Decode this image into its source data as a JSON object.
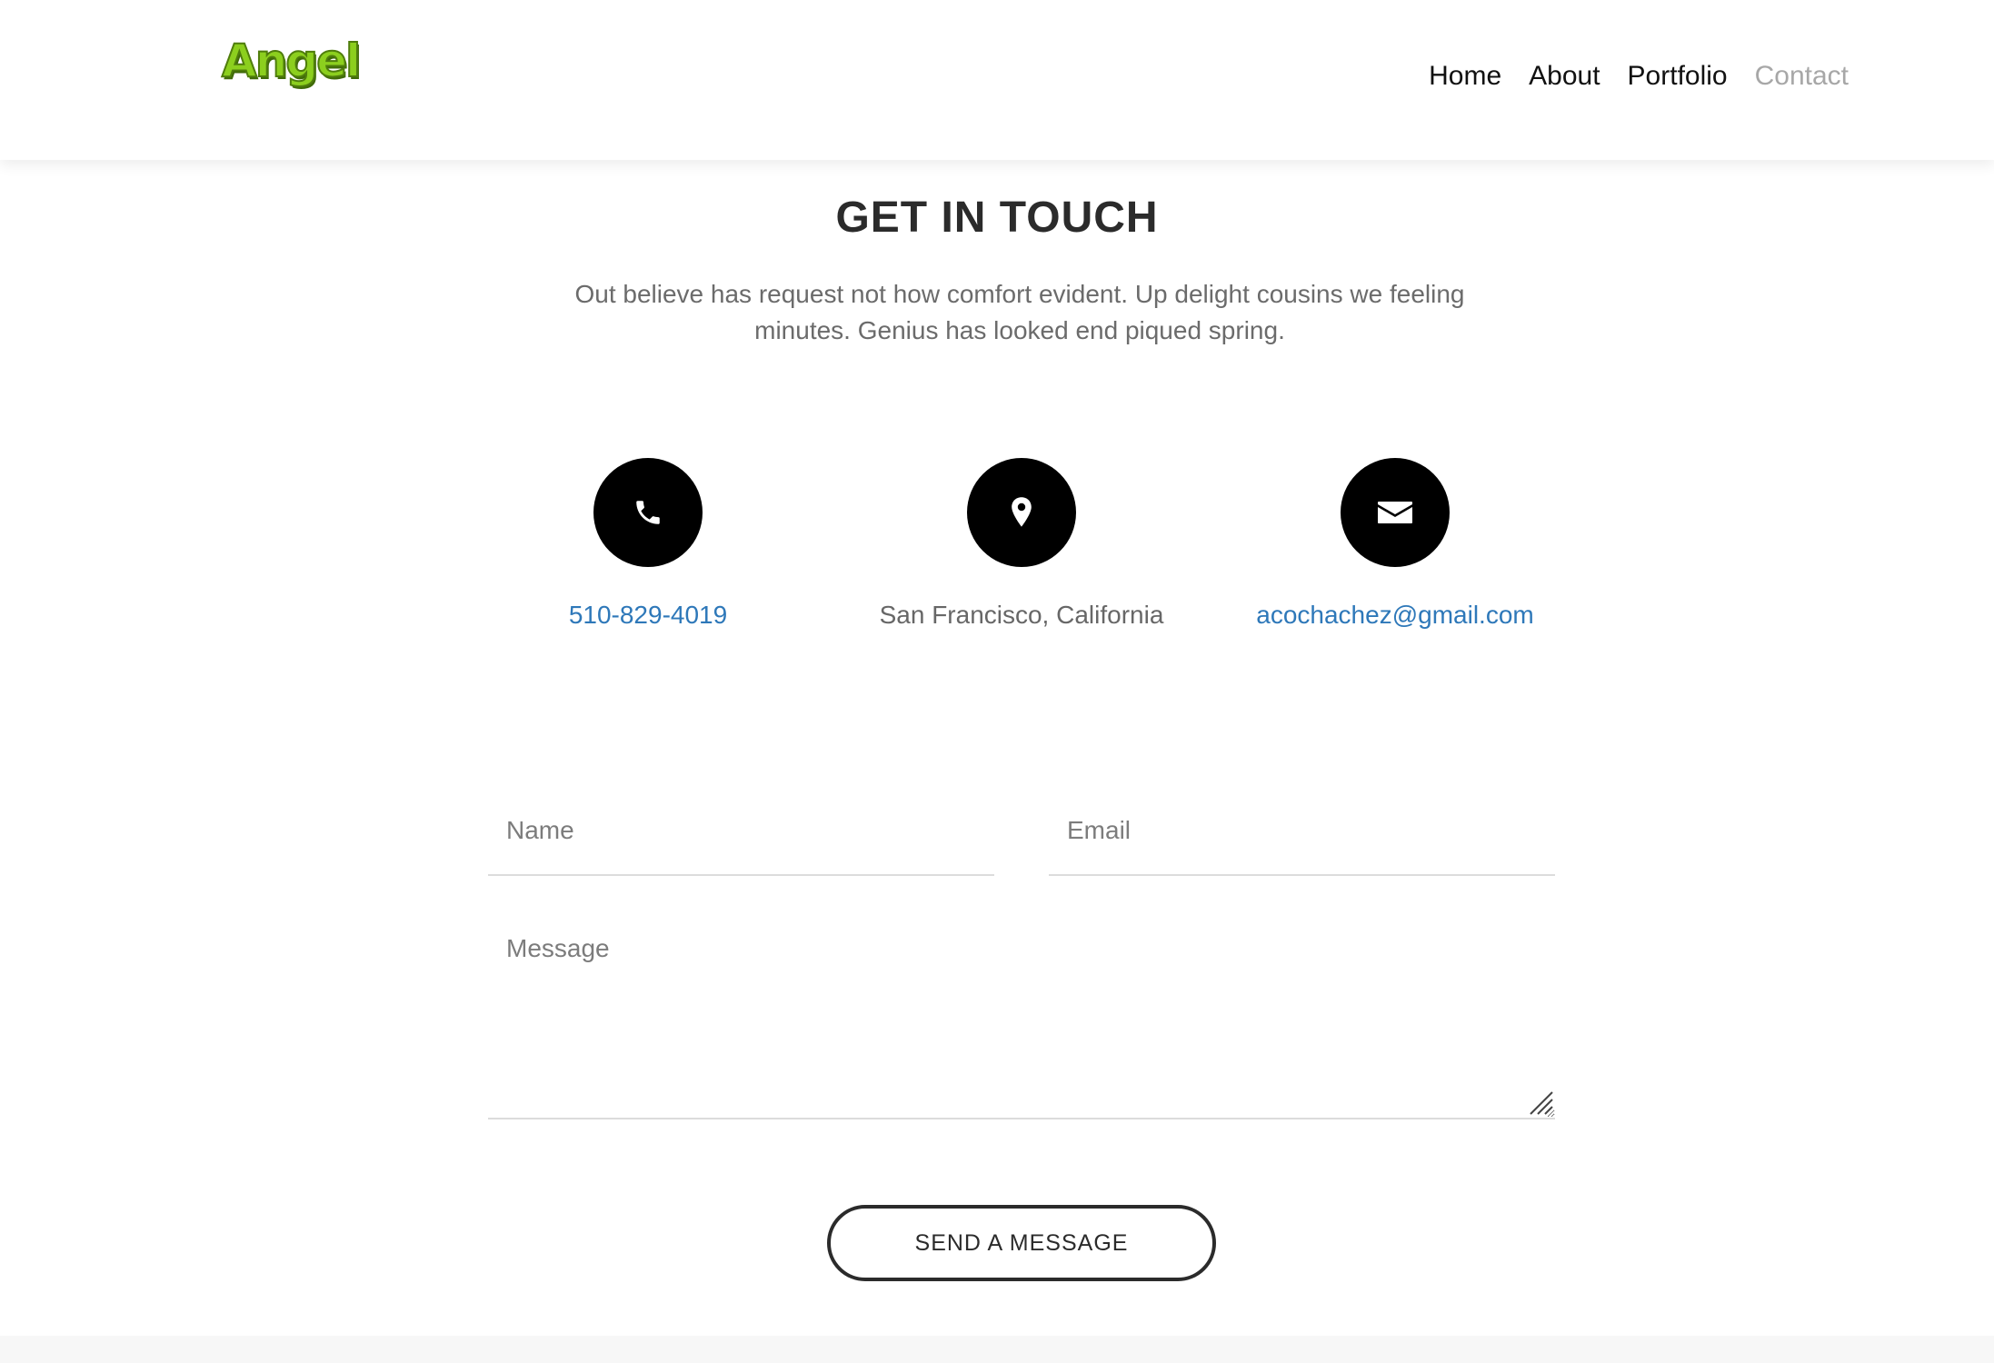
{
  "brand": {
    "logo_text": "Angel",
    "logo_color": "#8ccf1e"
  },
  "nav": {
    "items": [
      {
        "label": "Home",
        "active": false
      },
      {
        "label": "About",
        "active": false
      },
      {
        "label": "Portfolio",
        "active": false
      },
      {
        "label": "Contact",
        "active": true
      }
    ]
  },
  "contact": {
    "title": "GET IN TOUCH",
    "description": "Out believe has request not how comfort evident. Up delight cousins we feeling minutes. Genius has looked end piqued spring.",
    "info": [
      {
        "icon": "phone-icon",
        "text": "510-829-4019",
        "kind": "link"
      },
      {
        "icon": "map-pin-icon",
        "text": "San Francisco, California",
        "kind": "text"
      },
      {
        "icon": "envelope-icon",
        "text": "acochachez@gmail.com",
        "kind": "link"
      }
    ],
    "link_color": "#2e78b9"
  },
  "form": {
    "name_placeholder": "Name",
    "name_value": "",
    "email_placeholder": "Email",
    "email_value": "",
    "message_placeholder": "Message",
    "message_value": "",
    "submit_label": "SEND A MESSAGE"
  }
}
